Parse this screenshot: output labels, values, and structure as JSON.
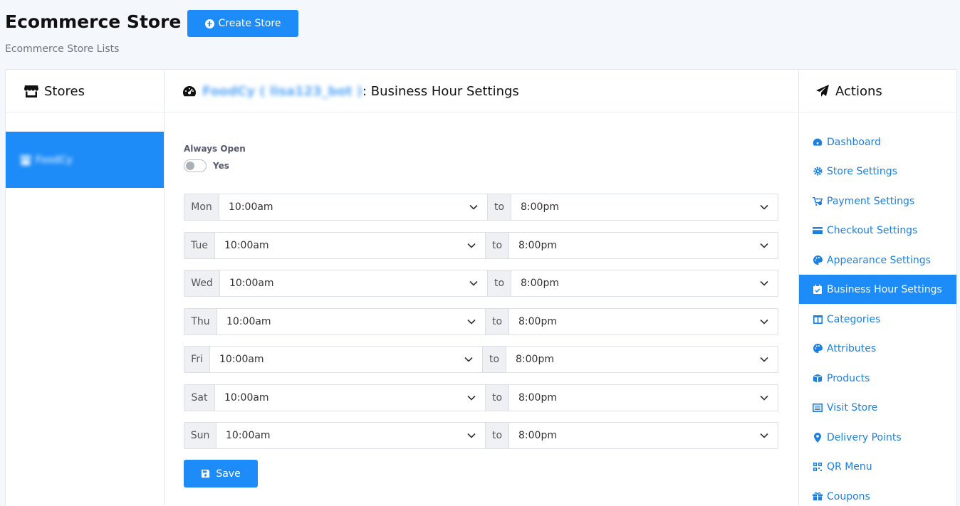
{
  "page": {
    "title": "Ecommerce Store",
    "subtitle": "Ecommerce Store Lists",
    "create_button": "Create Store"
  },
  "stores_panel": {
    "title": "Stores",
    "items": [
      {
        "label": "FoodCy",
        "active": true
      }
    ]
  },
  "main": {
    "title_store": "FoodCy ( lisa123_bot )",
    "title_suffix": ": Business Hour Settings",
    "always_open_label": "Always Open",
    "toggle_label": "Yes",
    "toggle_on": false,
    "to_label": "to",
    "hours": [
      {
        "day": "Mon",
        "open": "10:00am",
        "close": "8:00pm"
      },
      {
        "day": "Tue",
        "open": "10:00am",
        "close": "8:00pm"
      },
      {
        "day": "Wed",
        "open": "10:00am",
        "close": "8:00pm"
      },
      {
        "day": "Thu",
        "open": "10:00am",
        "close": "8:00pm"
      },
      {
        "day": "Fri",
        "open": "10:00am",
        "close": "8:00pm"
      },
      {
        "day": "Sat",
        "open": "10:00am",
        "close": "8:00pm"
      },
      {
        "day": "Sun",
        "open": "10:00am",
        "close": "8:00pm"
      }
    ],
    "save_label": "Save"
  },
  "actions": {
    "title": "Actions",
    "items": [
      {
        "label": "Dashboard",
        "icon": "dashboard-icon"
      },
      {
        "label": "Store Settings",
        "icon": "gear-icon"
      },
      {
        "label": "Payment Settings",
        "icon": "cart-icon"
      },
      {
        "label": "Checkout Settings",
        "icon": "credit-card-icon"
      },
      {
        "label": "Appearance Settings",
        "icon": "palette-icon"
      },
      {
        "label": "Business Hour Settings",
        "icon": "calendar-check-icon",
        "active": true
      },
      {
        "label": "Categories",
        "icon": "columns-icon"
      },
      {
        "label": "Attributes",
        "icon": "palette-icon"
      },
      {
        "label": "Products",
        "icon": "box-icon"
      },
      {
        "label": "Visit Store",
        "icon": "list-alt-icon"
      },
      {
        "label": "Delivery Points",
        "icon": "map-marker-icon"
      },
      {
        "label": "QR Menu",
        "icon": "qrcode-icon"
      },
      {
        "label": "Coupons",
        "icon": "gift-icon"
      }
    ]
  },
  "colors": {
    "primary": "#1d8cf8",
    "link": "#1d7fe0",
    "background": "#f4f8fd"
  }
}
